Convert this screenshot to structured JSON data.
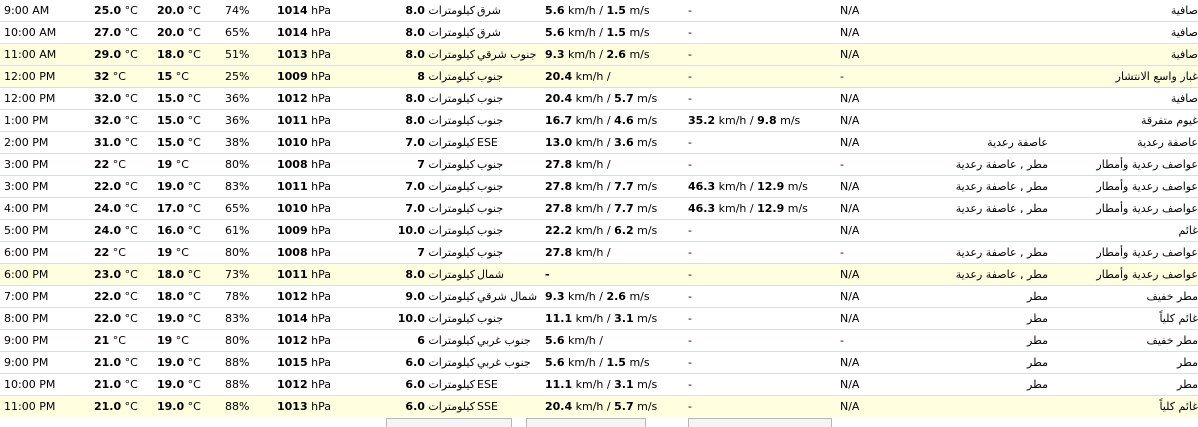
{
  "table": {
    "rows": [
      {
        "time": "9:00 AM",
        "temp": "25.0",
        "temp_unit": " °C",
        "dew": "20.0",
        "dew_unit": " °C",
        "hum": "74%",
        "pres": "1014",
        "pres_unit": " hPa",
        "vis": "8.0",
        "vis_unit": "كيلومترات ",
        "dir": "شرق",
        "wind": "5.6",
        "wind_sep": " km/h / ",
        "wind2": "1.5",
        "wind2_unit": " m/s",
        "gust": "-",
        "gust_val": "",
        "gust_sep": "",
        "gust_val2": "",
        "gust_unit": "",
        "precip": "N/A",
        "events": "",
        "cond": "صافية"
      },
      {
        "time": "10:00 AM",
        "temp": "27.0",
        "temp_unit": " °C",
        "dew": "20.0",
        "dew_unit": " °C",
        "hum": "65%",
        "pres": "1014",
        "pres_unit": " hPa",
        "vis": "8.0",
        "vis_unit": "كيلومترات ",
        "dir": "شرق",
        "wind": "5.6",
        "wind_sep": " km/h / ",
        "wind2": "1.5",
        "wind2_unit": " m/s",
        "gust": "-",
        "gust_val": "",
        "gust_sep": "",
        "gust_val2": "",
        "gust_unit": "",
        "precip": "N/A",
        "events": "",
        "cond": "صافية"
      },
      {
        "time": "11:00 AM",
        "temp": "29.0",
        "temp_unit": " °C",
        "dew": "18.0",
        "dew_unit": " °C",
        "hum": "51%",
        "pres": "1013",
        "pres_unit": " hPa",
        "vis": "8.0",
        "vis_unit": "كيلومترات ",
        "dir": "جنوب شرقي",
        "wind": "9.3",
        "wind_sep": " km/h / ",
        "wind2": "2.6",
        "wind2_unit": " m/s",
        "gust": "-",
        "gust_val": "",
        "gust_sep": "",
        "gust_val2": "",
        "gust_unit": "",
        "precip": "N/A",
        "events": "",
        "cond": "صافية"
      },
      {
        "time": "12:00 PM",
        "temp": "32",
        "temp_unit": " °C",
        "dew": "15",
        "dew_unit": " °C",
        "hum": "25%",
        "pres": "1009",
        "pres_unit": " hPa",
        "vis": "8",
        "vis_unit": "كيلومترات ",
        "dir": "جنوب",
        "wind": "20.4",
        "wind_sep": " km/h / ",
        "wind2": "",
        "wind2_unit": "",
        "gust": "-",
        "gust_val": "",
        "gust_sep": "",
        "gust_val2": "",
        "gust_unit": "",
        "precip": "-",
        "events": "",
        "cond": "غبار واسع الانتشار"
      },
      {
        "time": "12:00 PM",
        "temp": "32.0",
        "temp_unit": " °C",
        "dew": "15.0",
        "dew_unit": " °C",
        "hum": "36%",
        "pres": "1012",
        "pres_unit": " hPa",
        "vis": "8.0",
        "vis_unit": "كيلومترات ",
        "dir": "جنوب",
        "wind": "20.4",
        "wind_sep": " km/h / ",
        "wind2": "5.7",
        "wind2_unit": " m/s",
        "gust": "-",
        "gust_val": "",
        "gust_sep": "",
        "gust_val2": "",
        "gust_unit": "",
        "precip": "N/A",
        "events": "",
        "cond": "صافية"
      },
      {
        "time": "1:00 PM",
        "temp": "32.0",
        "temp_unit": " °C",
        "dew": "15.0",
        "dew_unit": " °C",
        "hum": "36%",
        "pres": "1011",
        "pres_unit": " hPa",
        "vis": "8.0",
        "vis_unit": "كيلومترات ",
        "dir": "جنوب",
        "wind": "16.7",
        "wind_sep": " km/h / ",
        "wind2": "4.6",
        "wind2_unit": " m/s",
        "gust": "",
        "gust_val": "35.2",
        "gust_sep": " km/h / ",
        "gust_val2": "9.8",
        "gust_unit": " m/s",
        "precip": "N/A",
        "events": "",
        "cond": "غيوم متفرقة"
      },
      {
        "time": "2:00 PM",
        "temp": "31.0",
        "temp_unit": " °C",
        "dew": "15.0",
        "dew_unit": " °C",
        "hum": "38%",
        "pres": "1010",
        "pres_unit": " hPa",
        "vis": "7.0",
        "vis_unit": "كيلومترات ",
        "dir": "ESE",
        "wind": "13.0",
        "wind_sep": " km/h / ",
        "wind2": "3.6",
        "wind2_unit": " m/s",
        "gust": "-",
        "gust_val": "",
        "gust_sep": "",
        "gust_val2": "",
        "gust_unit": "",
        "precip": "N/A",
        "events": "عاصفة رعدية",
        "cond": "عاصفة رعدية"
      },
      {
        "time": "3:00 PM",
        "temp": "22",
        "temp_unit": " °C",
        "dew": "19",
        "dew_unit": " °C",
        "hum": "80%",
        "pres": "1008",
        "pres_unit": " hPa",
        "vis": "7",
        "vis_unit": "كيلومترات ",
        "dir": "جنوب",
        "wind": "27.8",
        "wind_sep": " km/h / ",
        "wind2": "",
        "wind2_unit": "",
        "gust": "-",
        "gust_val": "",
        "gust_sep": "",
        "gust_val2": "",
        "gust_unit": "",
        "precip": "-",
        "events": "مطر , عاصفة رعدية",
        "cond": "عواصف رعدية وأمطار"
      },
      {
        "time": "3:00 PM",
        "temp": "22.0",
        "temp_unit": " °C",
        "dew": "19.0",
        "dew_unit": " °C",
        "hum": "83%",
        "pres": "1011",
        "pres_unit": " hPa",
        "vis": "7.0",
        "vis_unit": "كيلومترات ",
        "dir": "جنوب",
        "wind": "27.8",
        "wind_sep": " km/h / ",
        "wind2": "7.7",
        "wind2_unit": " m/s",
        "gust": "",
        "gust_val": "46.3",
        "gust_sep": " km/h / ",
        "gust_val2": "12.9",
        "gust_unit": " m/s",
        "precip": "N/A",
        "events": "مطر , عاصفة رعدية",
        "cond": "عواصف رعدية وأمطار"
      },
      {
        "time": "4:00 PM",
        "temp": "24.0",
        "temp_unit": " °C",
        "dew": "17.0",
        "dew_unit": " °C",
        "hum": "65%",
        "pres": "1010",
        "pres_unit": " hPa",
        "vis": "7.0",
        "vis_unit": "كيلومترات ",
        "dir": "جنوب",
        "wind": "27.8",
        "wind_sep": " km/h / ",
        "wind2": "7.7",
        "wind2_unit": " m/s",
        "gust": "",
        "gust_val": "46.3",
        "gust_sep": " km/h / ",
        "gust_val2": "12.9",
        "gust_unit": " m/s",
        "precip": "N/A",
        "events": "مطر , عاصفة رعدية",
        "cond": "عواصف رعدية وأمطار"
      },
      {
        "time": "5:00 PM",
        "temp": "24.0",
        "temp_unit": " °C",
        "dew": "16.0",
        "dew_unit": " °C",
        "hum": "61%",
        "pres": "1009",
        "pres_unit": " hPa",
        "vis": "10.0",
        "vis_unit": "كيلومترات ",
        "dir": "جنوب",
        "wind": "22.2",
        "wind_sep": " km/h / ",
        "wind2": "6.2",
        "wind2_unit": " m/s",
        "gust": "-",
        "gust_val": "",
        "gust_sep": "",
        "gust_val2": "",
        "gust_unit": "",
        "precip": "N/A",
        "events": "",
        "cond": "غائم"
      },
      {
        "time": "6:00 PM",
        "temp": "22",
        "temp_unit": " °C",
        "dew": "19",
        "dew_unit": " °C",
        "hum": "80%",
        "pres": "1008",
        "pres_unit": " hPa",
        "vis": "7",
        "vis_unit": "كيلومترات ",
        "dir": "جنوب",
        "wind": "27.8",
        "wind_sep": " km/h / ",
        "wind2": "",
        "wind2_unit": "",
        "gust": "-",
        "gust_val": "",
        "gust_sep": "",
        "gust_val2": "",
        "gust_unit": "",
        "precip": "-",
        "events": "مطر , عاصفة رعدية",
        "cond": "عواصف رعدية وأمطار"
      },
      {
        "time": "6:00 PM",
        "temp": "23.0",
        "temp_unit": " °C",
        "dew": "18.0",
        "dew_unit": " °C",
        "hum": "73%",
        "pres": "1011",
        "pres_unit": " hPa",
        "vis": "8.0",
        "vis_unit": "كيلومترات ",
        "dir": "شمال",
        "wind": "-",
        "wind_sep": "",
        "wind2": "",
        "wind2_unit": "",
        "gust": "-",
        "gust_val": "",
        "gust_sep": "",
        "gust_val2": "",
        "gust_unit": "",
        "precip": "N/A",
        "events": "مطر , عاصفة رعدية",
        "cond": "عواصف رعدية وأمطار"
      },
      {
        "time": "7:00 PM",
        "temp": "22.0",
        "temp_unit": " °C",
        "dew": "18.0",
        "dew_unit": " °C",
        "hum": "78%",
        "pres": "1012",
        "pres_unit": " hPa",
        "vis": "9.0",
        "vis_unit": "كيلومترات ",
        "dir": "شمال شرقي",
        "wind": "9.3",
        "wind_sep": " km/h / ",
        "wind2": "2.6",
        "wind2_unit": " m/s",
        "gust": "-",
        "gust_val": "",
        "gust_sep": "",
        "gust_val2": "",
        "gust_unit": "",
        "precip": "N/A",
        "events": "مطر",
        "cond": "مطر خفيف"
      },
      {
        "time": "8:00 PM",
        "temp": "22.0",
        "temp_unit": " °C",
        "dew": "19.0",
        "dew_unit": " °C",
        "hum": "83%",
        "pres": "1014",
        "pres_unit": " hPa",
        "vis": "10.0",
        "vis_unit": "كيلومترات ",
        "dir": "جنوب",
        "wind": "11.1",
        "wind_sep": " km/h / ",
        "wind2": "3.1",
        "wind2_unit": " m/s",
        "gust": "-",
        "gust_val": "",
        "gust_sep": "",
        "gust_val2": "",
        "gust_unit": "",
        "precip": "N/A",
        "events": "مطر",
        "cond": "غائم كلياً"
      },
      {
        "time": "9:00 PM",
        "temp": "21",
        "temp_unit": " °C",
        "dew": "19",
        "dew_unit": " °C",
        "hum": "80%",
        "pres": "1012",
        "pres_unit": " hPa",
        "vis": "6",
        "vis_unit": "كيلومترات ",
        "dir": "جنوب غربي",
        "wind": "5.6",
        "wind_sep": " km/h / ",
        "wind2": "",
        "wind2_unit": "",
        "gust": "-",
        "gust_val": "",
        "gust_sep": "",
        "gust_val2": "",
        "gust_unit": "",
        "precip": "-",
        "events": "مطر",
        "cond": "مطر خفيف"
      },
      {
        "time": "9:00 PM",
        "temp": "21.0",
        "temp_unit": " °C",
        "dew": "19.0",
        "dew_unit": " °C",
        "hum": "88%",
        "pres": "1015",
        "pres_unit": " hPa",
        "vis": "6.0",
        "vis_unit": "كيلومترات ",
        "dir": "جنوب غربي",
        "wind": "5.6",
        "wind_sep": " km/h / ",
        "wind2": "1.5",
        "wind2_unit": " m/s",
        "gust": "-",
        "gust_val": "",
        "gust_sep": "",
        "gust_val2": "",
        "gust_unit": "",
        "precip": "N/A",
        "events": "مطر",
        "cond": "مطر"
      },
      {
        "time": "10:00 PM",
        "temp": "21.0",
        "temp_unit": " °C",
        "dew": "19.0",
        "dew_unit": " °C",
        "hum": "88%",
        "pres": "1012",
        "pres_unit": " hPa",
        "vis": "6.0",
        "vis_unit": "كيلومترات ",
        "dir": "ESE",
        "wind": "11.1",
        "wind_sep": " km/h / ",
        "wind2": "3.1",
        "wind2_unit": " m/s",
        "gust": "-",
        "gust_val": "",
        "gust_sep": "",
        "gust_val2": "",
        "gust_unit": "",
        "precip": "N/A",
        "events": "مطر",
        "cond": "مطر"
      },
      {
        "time": "11:00 PM",
        "temp": "21.0",
        "temp_unit": " °C",
        "dew": "19.0",
        "dew_unit": " °C",
        "hum": "88%",
        "pres": "1013",
        "pres_unit": " hPa",
        "vis": "6.0",
        "vis_unit": "كيلومترات ",
        "dir": "SSE",
        "wind": "20.4",
        "wind_sep": " km/h / ",
        "wind2": "5.7",
        "wind2_unit": " m/s",
        "gust": "-",
        "gust_val": "",
        "gust_sep": "",
        "gust_val2": "",
        "gust_unit": "",
        "precip": "N/A",
        "events": "",
        "cond": "غائم كلياً"
      }
    ]
  }
}
